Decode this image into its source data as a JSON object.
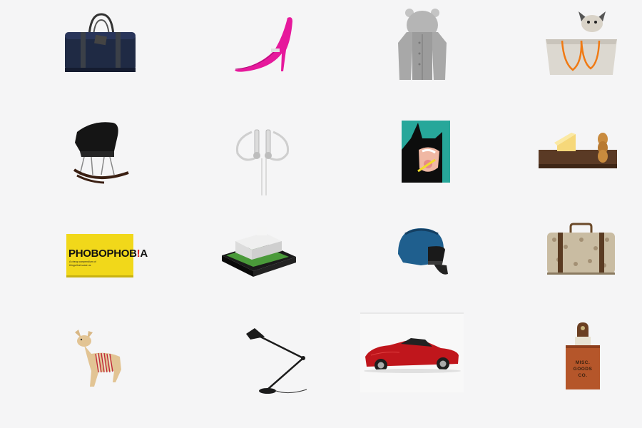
{
  "products": [
    {
      "name": "duffel-bag"
    },
    {
      "name": "pink-stiletto"
    },
    {
      "name": "bear-hoodie"
    },
    {
      "name": "dog-tote"
    },
    {
      "name": "rocking-chair"
    },
    {
      "name": "earphones"
    },
    {
      "name": "batman-art"
    },
    {
      "name": "cheese-board"
    },
    {
      "name": "phobophobia-book"
    },
    {
      "name": "lego-villa"
    },
    {
      "name": "helmet"
    },
    {
      "name": "floral-suitcase"
    },
    {
      "name": "wooden-fawn"
    },
    {
      "name": "desk-lamp"
    },
    {
      "name": "red-sports-car"
    },
    {
      "name": "misc-goods-tag"
    }
  ],
  "book": {
    "title_main": "PHOBOPHOB",
    "title_accent": "!",
    "title_end": "A",
    "subtitle_1": "A cheap compendium of",
    "subtitle_2": "things that scare us"
  },
  "tag": {
    "line1": "MISC.",
    "line2": "GOODS",
    "line3": "CO."
  },
  "colors": {
    "background": "#f5f5f6",
    "book_yellow": "#f1d81a",
    "shoe_pink": "#e6199c",
    "car_red": "#c0161c",
    "helmet_blue": "#1f5f8e",
    "batman_teal": "#27a79a"
  }
}
